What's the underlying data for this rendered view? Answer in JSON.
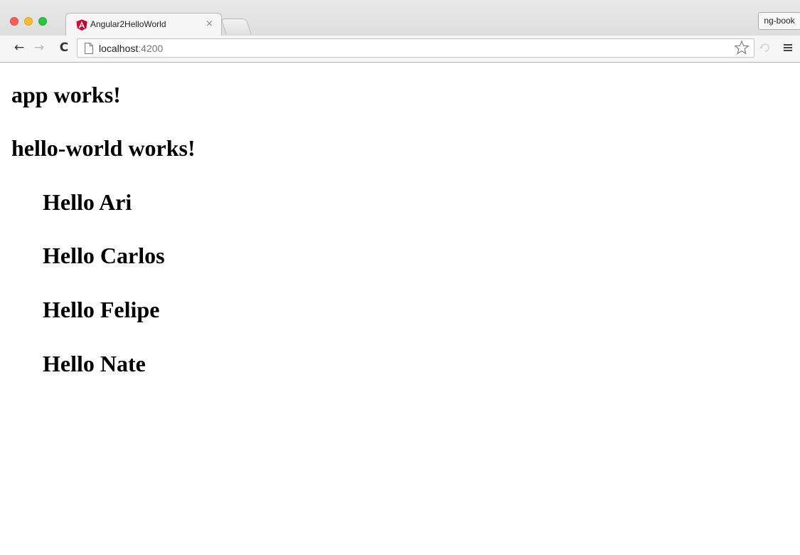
{
  "tab": {
    "title": "Angular2HelloWorld",
    "close_glyph": "×",
    "favicon": "angular-icon"
  },
  "profile": {
    "label": "ng-book"
  },
  "toolbar": {
    "back_glyph": "←",
    "forward_glyph": "→",
    "reload_glyph": "C",
    "url_host": "localhost",
    "url_port": ":4200"
  },
  "content": {
    "app_heading": "app works!",
    "hello_heading": "hello-world works!",
    "greetings": [
      "Hello Ari",
      "Hello Carlos",
      "Hello Felipe",
      "Hello Nate"
    ]
  },
  "colors": {
    "close_red": "#fc5f57",
    "minimize_yellow": "#fdbc2e",
    "zoom_green": "#28c840",
    "angular_red": "#dd0031"
  }
}
